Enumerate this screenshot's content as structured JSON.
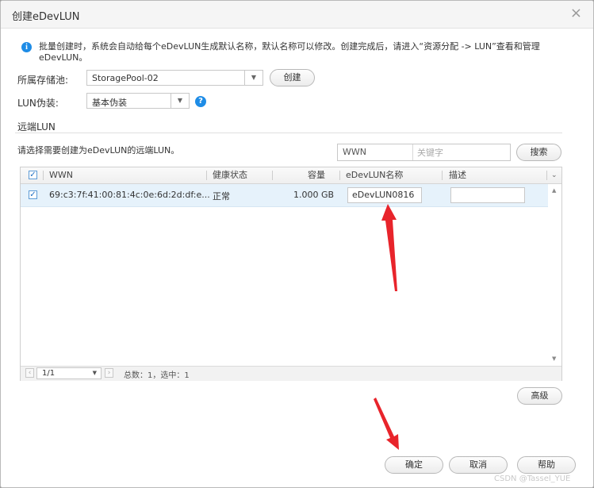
{
  "dialog": {
    "title": "创建eDevLUN",
    "close_symbol": "×"
  },
  "info": {
    "icon_text": "i",
    "text": "批量创建时，系统会自动给每个eDevLUN生成默认名称，默认名称可以修改。创建完成后，请进入“资源分配 -> LUN”查看和管理eDevLUN。"
  },
  "form": {
    "pool_label": "所属存储池:",
    "pool_value": "StoragePool-02",
    "create_button": "创建",
    "masquerade_label": "LUN伪装:",
    "masquerade_value": "基本伪装",
    "help_icon_text": "?"
  },
  "remote_lun": {
    "section_title": "远端LUN",
    "hint": "请选择需要创建为eDevLUN的远端LUN。",
    "search": {
      "type": "WWN",
      "placeholder": "关键字",
      "button": "搜索"
    }
  },
  "table": {
    "columns": [
      "WWN",
      "健康状态",
      "容量",
      "eDevLUN名称",
      "描述"
    ],
    "rows": [
      {
        "checked": true,
        "wwn": "69:c3:7f:41:00:81:4c:0e:6d:2d:df:e...",
        "health": "正常",
        "capacity": "1.000 GB",
        "edev_name": "eDevLUN0816",
        "description": ""
      }
    ],
    "pager": {
      "page": "1/1",
      "total_text": "总数：1，选中：1"
    }
  },
  "footer": {
    "advanced": "高级",
    "ok": "确定",
    "cancel": "取消",
    "help": "帮助"
  },
  "watermark": "CSDN @Tassel_YUE",
  "colors": {
    "accent": "#1e8ce6",
    "selected_row": "#e6f2fb",
    "annotation_arrow": "#e8242b"
  }
}
